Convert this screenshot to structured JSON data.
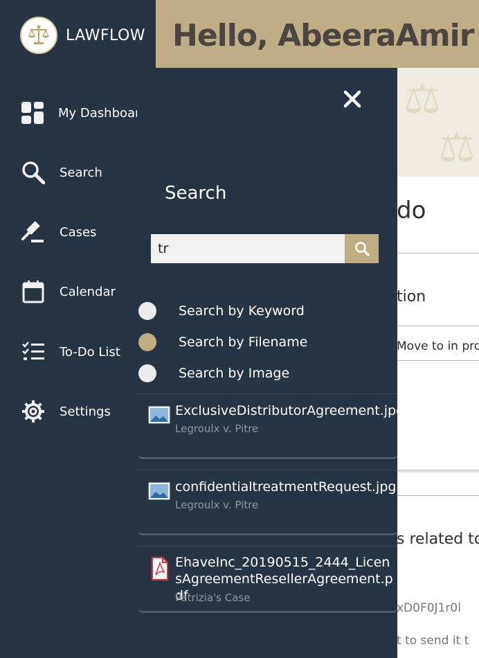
{
  "app": {
    "brand": "LAWFLOW",
    "greeting": "Hello, AbeeraAmir"
  },
  "sidebar": {
    "items": [
      {
        "label": "My Dashboard",
        "icon": "dashboard-icon"
      },
      {
        "label": "Search",
        "icon": "search-icon"
      },
      {
        "label": "Cases",
        "icon": "gavel-icon"
      },
      {
        "label": "Calendar",
        "icon": "calendar-icon"
      },
      {
        "label": "To-Do List",
        "icon": "checklist-icon"
      },
      {
        "label": "Settings",
        "icon": "gear-icon"
      }
    ]
  },
  "search_panel": {
    "title": "Search",
    "query": "tr",
    "options": [
      {
        "label": "Search by Keyword",
        "selected": false
      },
      {
        "label": "Search by Filename",
        "selected": true
      },
      {
        "label": "Search by Image",
        "selected": false
      }
    ],
    "results": [
      {
        "name": "ExclusiveDistributorAgreement.jpg",
        "case": "Legroulx v. Pitre",
        "type": "image"
      },
      {
        "name": "confidentialtreatmentRequest.jpg",
        "case": "Legroulx v. Pitre",
        "type": "image"
      },
      {
        "name": "EhaveInc_20190515_2444_LicensAgreementResellerAgreement.pdf",
        "case": "Patrizia's Case",
        "type": "pdf"
      }
    ]
  },
  "background": {
    "todo_fragment": "do",
    "section_fragment": "tion",
    "move_text": "Move to in prog",
    "related_fragment": "s related to",
    "code_fragment": "xD0F0J1r0l",
    "bottom_fragment": "t to send it t"
  },
  "colors": {
    "sidebar": "#263443",
    "accent": "#bfad85",
    "header_text": "#4a4541"
  }
}
